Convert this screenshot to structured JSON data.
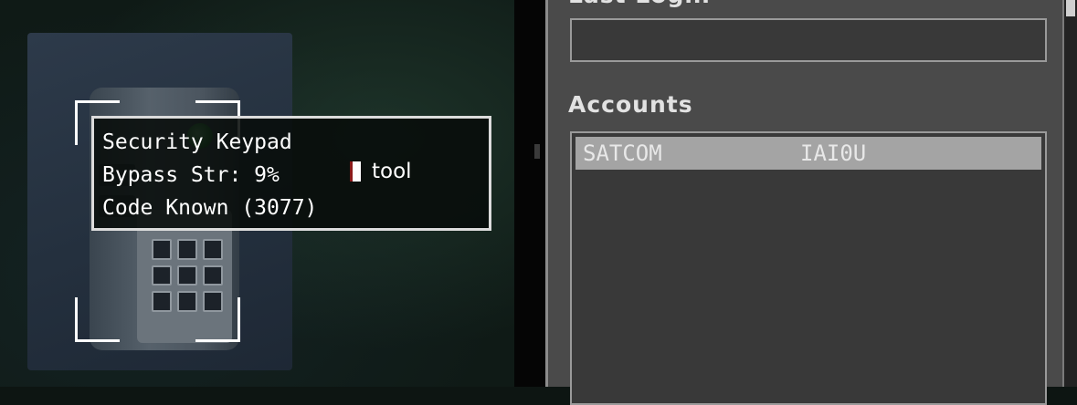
{
  "tooltip": {
    "title": "Security Keypad",
    "bypass": "Bypass Str: 9%",
    "code": "Code Known (3077)",
    "tool_label": "tool"
  },
  "panel": {
    "last_login_label": "Last Login",
    "last_login_value": "",
    "accounts_label": "Accounts",
    "accounts": [
      {
        "name": "SATCOM",
        "password": "IAI0U"
      }
    ]
  },
  "colors": {
    "panel_bg": "#4a4a4a",
    "selected_row": "#a4a4a4",
    "tooltip_border": "#dcdcdc",
    "led_green": "#2e8a3b"
  },
  "icons": [
    "keypad-led-icon",
    "tool-icon"
  ]
}
